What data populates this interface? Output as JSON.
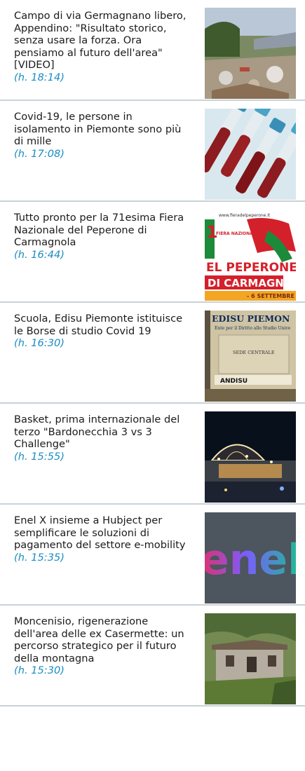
{
  "news": [
    {
      "title": "Campo di via Germagnano libero, Appendino: \"Risultato storico, senza usare la forza. Ora pensiamo al futuro dell'area\" [VIDEO]",
      "time": "(h. 18:14)",
      "image_icon": "demolished-camp-photo"
    },
    {
      "title": "Covid-19, le persone in isolamento in Piemonte sono più di mille",
      "time": "(h. 17:08)",
      "image_icon": "blood-sample-tubes-photo"
    },
    {
      "title": "Tutto pronto per la 71esima Fiera Nazionale del Peperone di Carmagnola",
      "time": "(h. 16:44)",
      "image_icon": "fiera-peperone-poster",
      "image_text": {
        "url": "www.fieradelpeperone.it",
        "badge": "FIERA NAZIONALE",
        "line1": "EL PEPERONE",
        "line2": "DI CARMAGNOLA",
        "dates": "- 6 SETTEMBRE"
      }
    },
    {
      "title": "Scuola, Edisu Piemonte istituisce le Borse di studio Covid 19",
      "time": "(h. 16:30)",
      "image_icon": "edisu-sign-photo",
      "image_text": {
        "header": "EDISU PIEMON",
        "sub": "Ente per il Diritto allo Studio Unive",
        "sign": "SEDE CENTRALE",
        "andisu": "ANDISU"
      }
    },
    {
      "title": "Basket, prima internazionale del terzo \"Bardonecchia 3 vs 3 Challenge\"",
      "time": "(h. 15:55)",
      "image_icon": "night-basket-court-photo"
    },
    {
      "title": "Enel X insieme a Hubject per semplificare le soluzioni di pagamento del settore e-mobility",
      "time": "(h. 15:35)",
      "image_icon": "enel-logo-sign-photo",
      "image_text": {
        "logo": "enel"
      }
    },
    {
      "title": "Moncenisio, rigenerazione dell'area delle ex Casermette: un percorso strategico per il futuro della montagna",
      "time": "(h. 15:30)",
      "image_icon": "ruined-barracks-photo"
    }
  ]
}
